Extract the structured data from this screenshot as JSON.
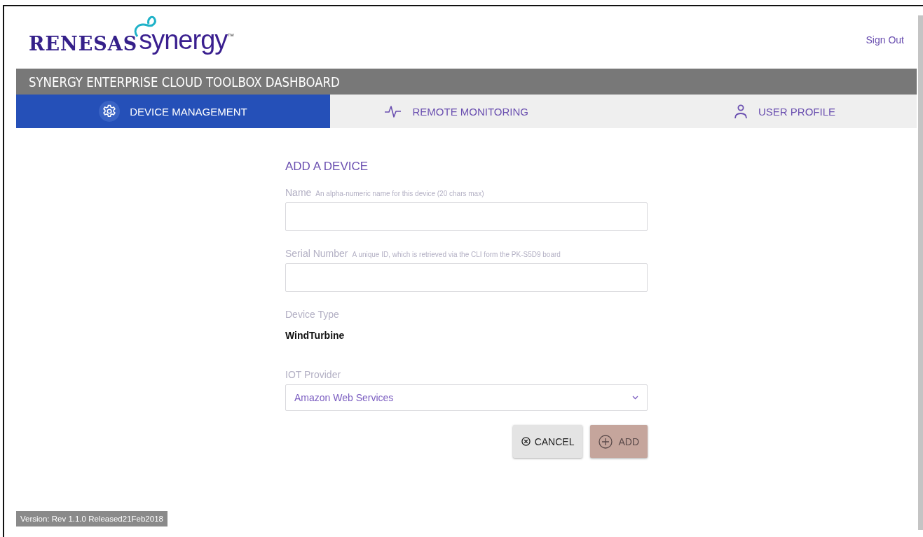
{
  "header": {
    "logo": {
      "brand": "RENESAS",
      "product": "synergy",
      "trademark": "™"
    },
    "sign_out": "Sign Out",
    "title": "SYNERGY ENTERPRISE CLOUD TOOLBOX DASHBOARD"
  },
  "tabs": [
    {
      "label": "DEVICE MANAGEMENT",
      "kind": "gear",
      "selected": true
    },
    {
      "label": "REMOTE MONITORING",
      "kind": "pulse",
      "selected": false
    },
    {
      "label": "USER PROFILE",
      "kind": "person",
      "selected": false
    }
  ],
  "form": {
    "title": "ADD A DEVICE",
    "fields": [
      {
        "kind": "input",
        "label": "Name",
        "hint": "An alpha-numeric name for this device (20 chars max)"
      },
      {
        "kind": "input",
        "label": "Serial Number",
        "hint": "A unique ID, which is retrieved via the CLI form the PK-S5D9 board"
      },
      {
        "kind": "text",
        "label": "Device Type",
        "value": "WindTurbine"
      },
      {
        "kind": "select",
        "label": "IOT Provider",
        "value": "Amazon Web Services"
      }
    ],
    "buttons": [
      {
        "label": "CANCEL",
        "kind": "cancel",
        "disabled": false
      },
      {
        "label": "ADD",
        "kind": "plus",
        "disabled": true
      }
    ]
  },
  "version": "Version: Rev 1.1.0 Released21Feb2018"
}
